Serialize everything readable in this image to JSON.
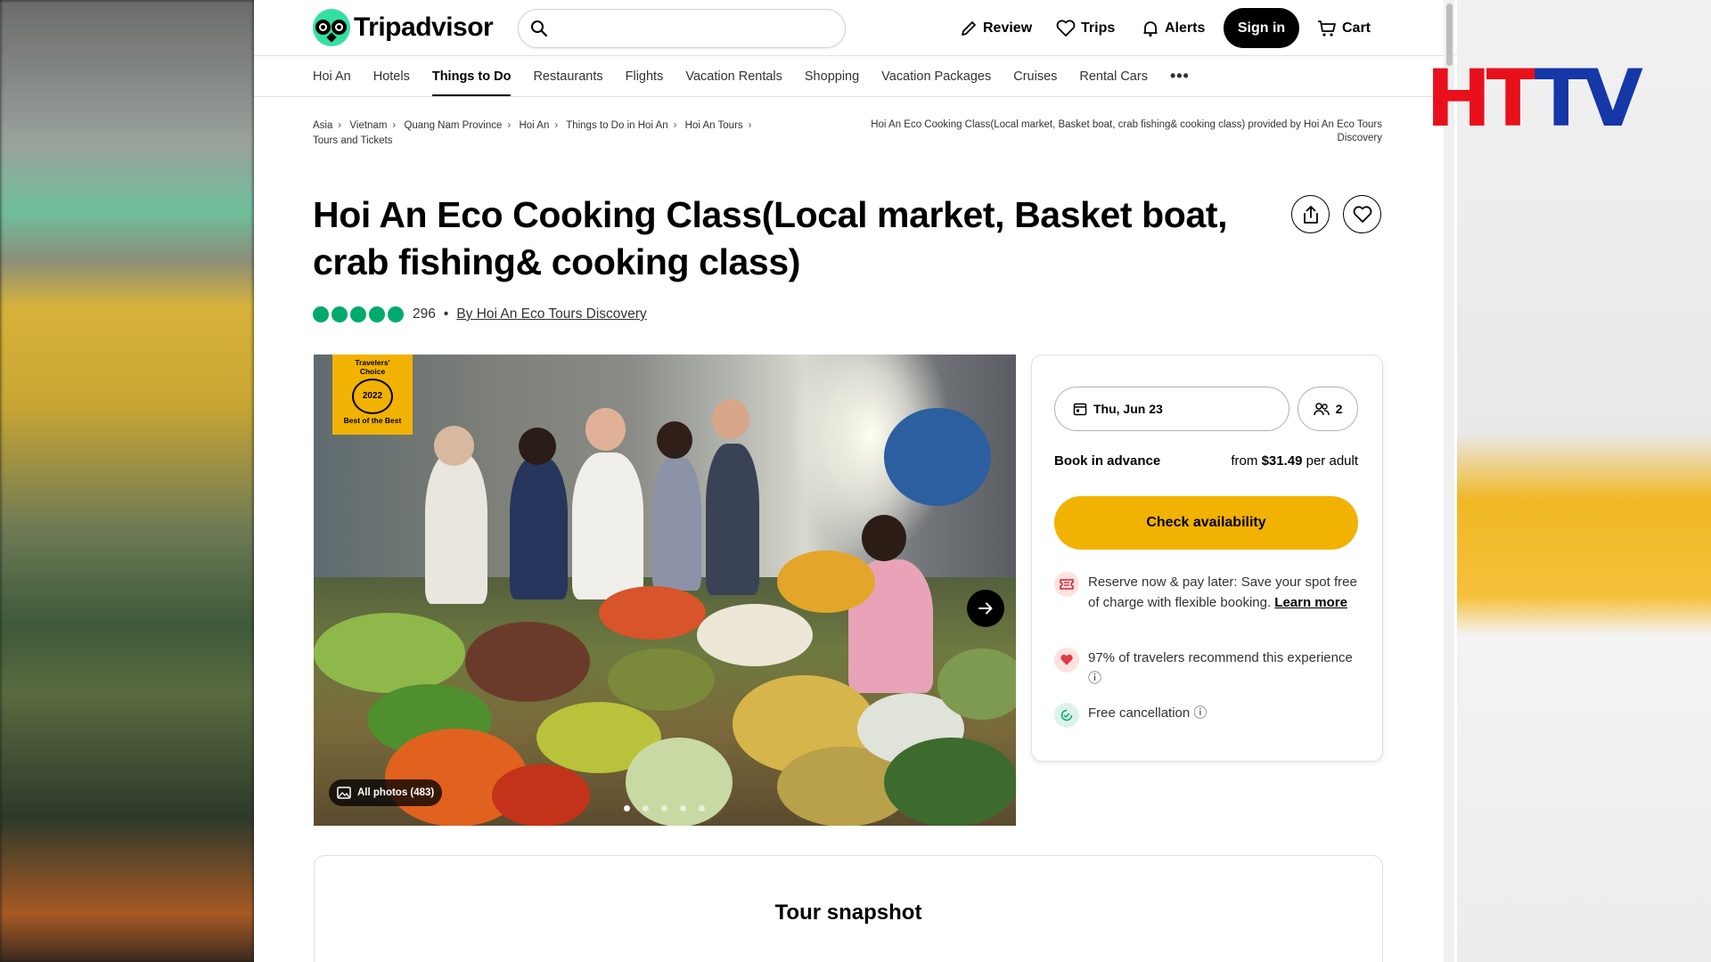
{
  "brand": {
    "name": "Tripadvisor"
  },
  "search": {
    "placeholder": ""
  },
  "header_nav": {
    "review": "Review",
    "trips": "Trips",
    "alerts": "Alerts",
    "signin": "Sign in",
    "cart": "Cart"
  },
  "tabs": [
    "Hoi An",
    "Hotels",
    "Things to Do",
    "Restaurants",
    "Flights",
    "Vacation Rentals",
    "Shopping",
    "Vacation Packages",
    "Cruises",
    "Rental Cars"
  ],
  "active_tab": "Things to Do",
  "breadcrumb": [
    "Asia",
    "Vietnam",
    "Quang Nam Province",
    "Hoi An",
    "Things to Do in Hoi An",
    "Hoi An Tours",
    "Tours and Tickets"
  ],
  "breadcrumb_current": "Hoi An Eco Cooking Class(Local market, Basket boat, crab fishing& cooking class) provided by Hoi An Eco Tours Discovery",
  "title": "Hoi An Eco Cooking Class(Local market, Basket boat, crab fishing& cooking class)",
  "rating": {
    "bubbles": 5,
    "count": "296",
    "separator": "•",
    "by": "By Hoi An Eco Tours Discovery"
  },
  "photo": {
    "badge_line1": "Travelers'",
    "badge_line2": "Choice",
    "badge_year": "2022",
    "badge_line3": "Best of the Best",
    "all_photos": "All photos (483)",
    "dots": 5,
    "active_dot": 0
  },
  "booking": {
    "date": "Thu, Jun 23",
    "travelers": "2",
    "book_label": "Book in advance",
    "price_prefix": "from",
    "price": "$31.49",
    "price_suffix": "per adult",
    "cta": "Check availability",
    "reserve_text": "Reserve now & pay later: Save your spot free of charge with flexible booking.",
    "learn_more": "Learn more",
    "recommend_text": "97% of travelers recommend this experience",
    "cancel_text": "Free cancellation"
  },
  "snapshot": {
    "title": "Tour snapshot"
  },
  "overlay_logo": {
    "letters": [
      "H",
      "T",
      "T",
      "V"
    ]
  },
  "colors": {
    "accent": "#f2b203",
    "green": "#00aa6c",
    "text": "#000000",
    "htv_red": "#e8101b",
    "htv_blue": "#1537a8"
  }
}
